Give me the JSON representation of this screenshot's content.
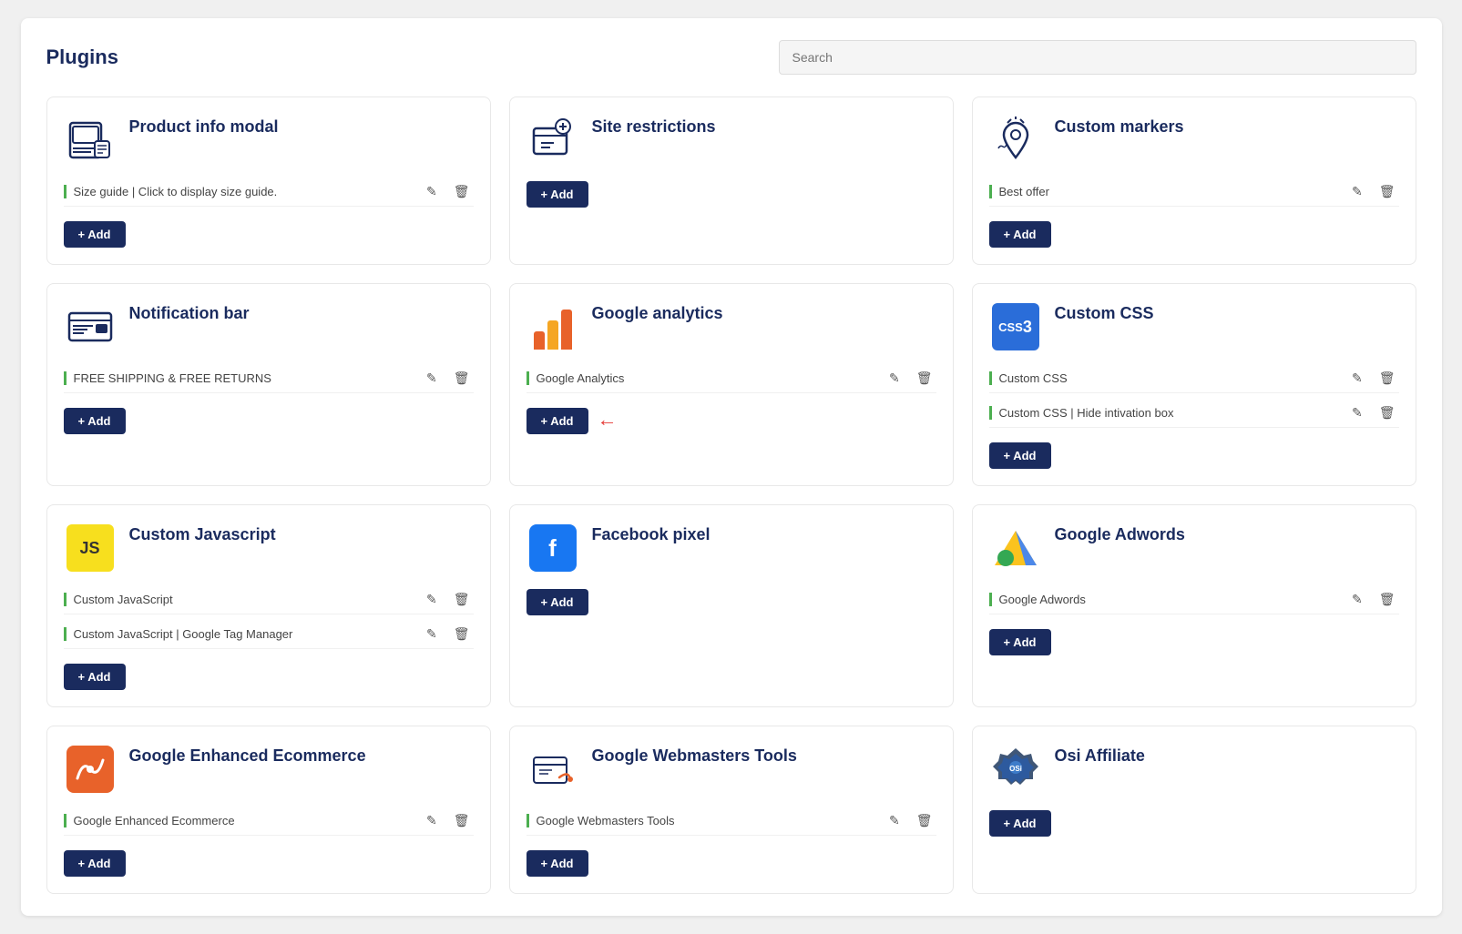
{
  "page": {
    "title": "Plugins",
    "search_placeholder": "Search"
  },
  "plugins": [
    {
      "id": "product-info-modal",
      "name": "Product info modal",
      "icon_type": "product-info",
      "instances": [
        {
          "label": "Size guide | Click to display size guide."
        }
      ],
      "has_add": true,
      "add_label": "+ Add"
    },
    {
      "id": "site-restrictions",
      "name": "Site restrictions",
      "icon_type": "site-restrictions",
      "instances": [],
      "has_add": true,
      "add_label": "+ Add"
    },
    {
      "id": "custom-markers",
      "name": "Custom markers",
      "icon_type": "custom-markers",
      "instances": [
        {
          "label": "Best offer"
        }
      ],
      "has_add": true,
      "add_label": "+ Add"
    },
    {
      "id": "notification-bar",
      "name": "Notification bar",
      "icon_type": "notification-bar",
      "instances": [
        {
          "label": "FREE SHIPPING & FREE RETURNS"
        }
      ],
      "has_add": true,
      "add_label": "+ Add"
    },
    {
      "id": "google-analytics",
      "name": "Google analytics",
      "icon_type": "google-analytics",
      "instances": [
        {
          "label": "Google Analytics"
        }
      ],
      "has_add": true,
      "add_label": "+ Add",
      "has_arrow": true
    },
    {
      "id": "custom-css",
      "name": "Custom CSS",
      "icon_type": "custom-css",
      "instances": [
        {
          "label": "Custom CSS"
        },
        {
          "label": "Custom CSS | Hide intivation box"
        }
      ],
      "has_add": true,
      "add_label": "+ Add"
    },
    {
      "id": "custom-javascript",
      "name": "Custom Javascript",
      "icon_type": "custom-js",
      "instances": [
        {
          "label": "Custom JavaScript"
        },
        {
          "label": "Custom JavaScript | Google Tag Manager"
        }
      ],
      "has_add": true,
      "add_label": "+ Add"
    },
    {
      "id": "facebook-pixel",
      "name": "Facebook pixel",
      "icon_type": "facebook-pixel",
      "instances": [],
      "has_add": true,
      "add_label": "+ Add"
    },
    {
      "id": "google-adwords",
      "name": "Google Adwords",
      "icon_type": "google-adwords",
      "instances": [
        {
          "label": "Google Adwords"
        }
      ],
      "has_add": true,
      "add_label": "+ Add"
    },
    {
      "id": "google-enhanced-ecommerce",
      "name": "Google Enhanced Ecommerce",
      "icon_type": "google-enhanced-ecommerce",
      "instances": [
        {
          "label": "Google Enhanced Ecommerce"
        }
      ],
      "has_add": true,
      "add_label": "+ Add"
    },
    {
      "id": "google-webmasters-tools",
      "name": "Google Webmasters Tools",
      "icon_type": "google-webmasters-tools",
      "instances": [
        {
          "label": "Google Webmasters Tools"
        }
      ],
      "has_add": true,
      "add_label": "+ Add"
    },
    {
      "id": "osi-affiliate",
      "name": "Osi Affiliate",
      "icon_type": "osi-affiliate",
      "instances": [],
      "has_add": true,
      "add_label": "+ Add"
    }
  ]
}
